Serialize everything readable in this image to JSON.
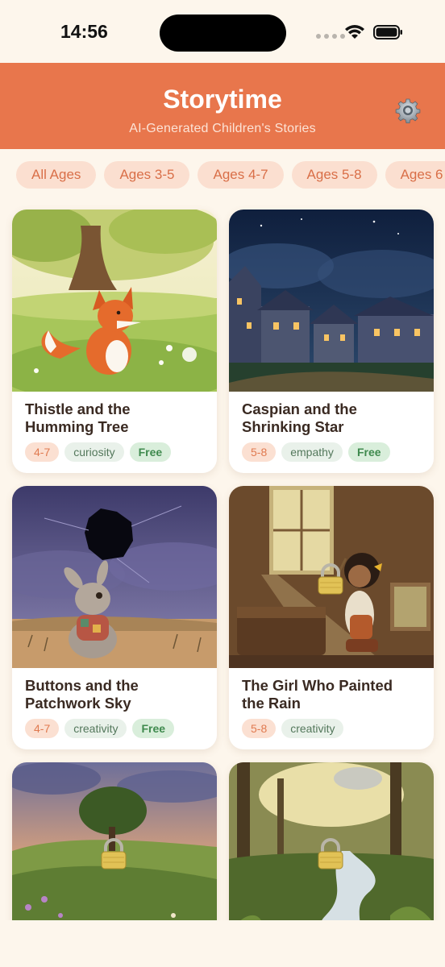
{
  "status_bar": {
    "time": "14:56"
  },
  "header": {
    "title": "Storytime",
    "subtitle": "AI-Generated Children's Stories",
    "settings_icon": "gear-icon"
  },
  "filters": [
    "All Ages",
    "Ages 3-5",
    "Ages 4-7",
    "Ages 5-8",
    "Ages 6"
  ],
  "colors": {
    "header": "#e8764c",
    "background": "#fdf6ec",
    "chip_bg": "#fbdfd0",
    "chip_text": "#d96f48"
  },
  "stories": [
    {
      "title_line1": "Thistle and the",
      "title_line2": "Humming Tree",
      "age": "4-7",
      "theme": "curiosity",
      "badge": "Free",
      "locked": false
    },
    {
      "title_line1": "Caspian and the",
      "title_line2": "Shrinking Star",
      "age": "5-8",
      "theme": "empathy",
      "badge": "Free",
      "locked": false
    },
    {
      "title_line1": "Buttons and the",
      "title_line2": "Patchwork Sky",
      "age": "4-7",
      "theme": "creativity",
      "badge": "Free",
      "locked": false
    },
    {
      "title_line1": "The Girl Who Painted",
      "title_line2": "the Rain",
      "age": "5-8",
      "theme": "creativity",
      "badge": "",
      "locked": true
    },
    {
      "title_line1": "",
      "title_line2": "",
      "age": "",
      "theme": "",
      "badge": "",
      "locked": true
    },
    {
      "title_line1": "",
      "title_line2": "",
      "age": "",
      "theme": "",
      "badge": "",
      "locked": true
    }
  ]
}
